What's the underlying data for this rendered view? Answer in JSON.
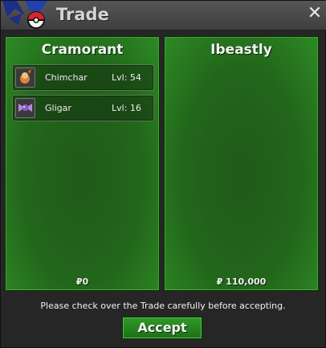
{
  "window": {
    "title": "Trade",
    "close_label": "✕",
    "colors": {
      "panel_green": "#22661b",
      "accent_green": "#2f9a25",
      "titlebar": "#4a4a4a"
    }
  },
  "left_panel": {
    "trainer": "Cramorant",
    "money": "₽0",
    "items": [
      {
        "name": "Chimchar",
        "level": "Lvl: 54",
        "sprite": "chimchar-sprite-icon"
      },
      {
        "name": "Gligar",
        "level": "Lvl: 16",
        "sprite": "gligar-sprite-icon"
      }
    ]
  },
  "right_panel": {
    "trainer": "Ibeastly",
    "money": "₽ 110,000",
    "items": []
  },
  "footer": {
    "note": "Please check over the Trade carefully before accepting.",
    "accept_label": "Accept"
  }
}
